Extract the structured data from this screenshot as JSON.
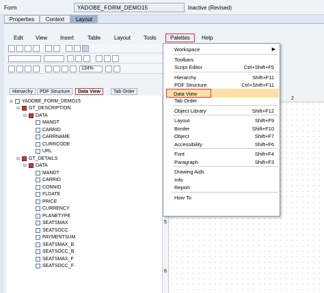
{
  "form": {
    "label": "Form",
    "name": "YADOBE_FORM_DEMO15",
    "status": "Inactive (Revised)"
  },
  "tabs": [
    "Properties",
    "Context",
    "Layout"
  ],
  "menubar": [
    "Edit",
    "View",
    "Insert",
    "Table",
    "Layout",
    "Tools",
    "Palettes",
    "Help"
  ],
  "toolbar": {
    "zoom": "134%"
  },
  "panel_tabs": [
    "Hierarchy",
    "PDF Structure",
    "Data View",
    "Tab Order"
  ],
  "tree": [
    {
      "label": "YADOBE_FORM_DEMO15",
      "level": 0,
      "kind": "root"
    },
    {
      "label": "GT_DESCRIPTION",
      "level": 1,
      "kind": "table"
    },
    {
      "label": "DATA",
      "level": 2,
      "kind": "table"
    },
    {
      "label": "MANDT",
      "level": 3,
      "kind": "field"
    },
    {
      "label": "CARRID",
      "level": 3,
      "kind": "field"
    },
    {
      "label": "CARRNAME",
      "level": 3,
      "kind": "field"
    },
    {
      "label": "CURRCODE",
      "level": 3,
      "kind": "field"
    },
    {
      "label": "URL",
      "level": 3,
      "kind": "field"
    },
    {
      "label": "GT_DETAILS",
      "level": 1,
      "kind": "table"
    },
    {
      "label": "DATA",
      "level": 2,
      "kind": "table"
    },
    {
      "label": "MANDT",
      "level": 3,
      "kind": "field"
    },
    {
      "label": "CARRID",
      "level": 3,
      "kind": "field"
    },
    {
      "label": "CONNID",
      "level": 3,
      "kind": "field"
    },
    {
      "label": "FLDATE",
      "level": 3,
      "kind": "field"
    },
    {
      "label": "PRICE",
      "level": 3,
      "kind": "field"
    },
    {
      "label": "CURRENCY",
      "level": 3,
      "kind": "field"
    },
    {
      "label": "PLANETYPE",
      "level": 3,
      "kind": "field"
    },
    {
      "label": "SEATSMAX",
      "level": 3,
      "kind": "field"
    },
    {
      "label": "SEATSOCC",
      "level": 3,
      "kind": "field"
    },
    {
      "label": "PAYMENTSUM",
      "level": 3,
      "kind": "field"
    },
    {
      "label": "SEATSMAX_B",
      "level": 3,
      "kind": "field"
    },
    {
      "label": "SEATSOCC_B",
      "level": 3,
      "kind": "field"
    },
    {
      "label": "SEATSMAX_F",
      "level": 3,
      "kind": "field"
    },
    {
      "label": "SEATSOCC_F",
      "level": 3,
      "kind": "field"
    }
  ],
  "palettes_menu": [
    {
      "label": "Workspace",
      "shortcut": "",
      "submenu": true
    },
    {
      "sep": true
    },
    {
      "label": "Toolbars",
      "shortcut": ""
    },
    {
      "label": "Script Editor",
      "shortcut": "Ctrl+Shift+F5"
    },
    {
      "sep": true
    },
    {
      "label": "Hierarchy",
      "shortcut": "Shift+F11"
    },
    {
      "label": "PDF Structure",
      "shortcut": "Ctrl+Shift+F11"
    },
    {
      "label": "Data View",
      "shortcut": "",
      "highlight": true
    },
    {
      "label": "Tab Order",
      "shortcut": ""
    },
    {
      "sep": true
    },
    {
      "label": "Object Library",
      "shortcut": "Shift+F12"
    },
    {
      "sep": true
    },
    {
      "label": "Layout",
      "shortcut": "Shift+F9"
    },
    {
      "label": "Border",
      "shortcut": "Shift+F10"
    },
    {
      "label": "Object",
      "shortcut": "Shift+F7"
    },
    {
      "label": "Accessibility",
      "shortcut": "Shift+F6"
    },
    {
      "sep": true
    },
    {
      "label": "Font",
      "shortcut": "Shift+F4"
    },
    {
      "label": "Paragraph",
      "shortcut": "Shift+F3"
    },
    {
      "sep": true
    },
    {
      "label": "Drawing Aids",
      "shortcut": ""
    },
    {
      "label": "Info",
      "shortcut": ""
    },
    {
      "label": "Report",
      "shortcut": ""
    },
    {
      "sep": true
    },
    {
      "label": "How To",
      "shortcut": ""
    }
  ],
  "ruler": {
    "h_mark": "2",
    "v_marks": [
      "5",
      "6"
    ]
  },
  "colors": {
    "highlight": "#fbe1a6",
    "accent_border": "#e0303a"
  }
}
